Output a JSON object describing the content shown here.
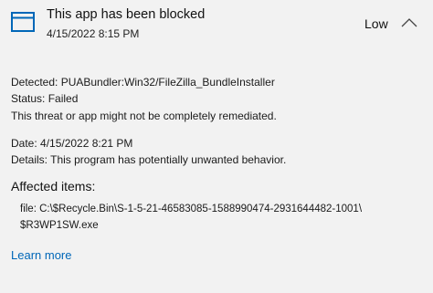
{
  "header": {
    "title": "This app has been blocked",
    "timestamp": "4/15/2022 8:15 PM",
    "severity": "Low",
    "icon": "app-window-icon",
    "collapse_icon": "chevron-up-icon"
  },
  "details1": {
    "detected": "Detected: PUABundler:Win32/FileZilla_BundleInstaller",
    "status": "Status: Failed",
    "remediation": "This threat or app might not be completely remediated."
  },
  "details2": {
    "date": "Date: 4/15/2022 8:21 PM",
    "details": "Details: This program has potentially unwanted behavior."
  },
  "affected": {
    "title": "Affected items:",
    "path_line1": "file: C:\\$Recycle.Bin\\S-1-5-21-46583085-1588990474-2931644482-1001\\",
    "path_line2": "$R3WP1SW.exe"
  },
  "links": {
    "learn_more": "Learn more"
  },
  "colors": {
    "accent": "#0067b8",
    "background": "#f2f2f2"
  }
}
